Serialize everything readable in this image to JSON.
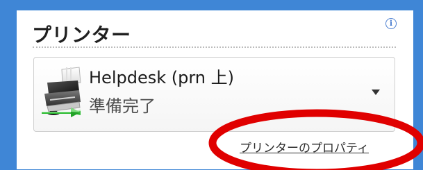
{
  "printer_section": {
    "title": "プリンター",
    "info_icon": "info-icon",
    "selected_printer": {
      "name": "Helpdesk (prn 上)",
      "status": "準備完了",
      "icon": "printer-icon"
    },
    "dropdown_icon": "chevron-down-icon",
    "properties_link": "プリンターのプロパティ"
  },
  "colors": {
    "frame": "#3f86d6",
    "panel_background": "#ffffff",
    "annotation": "#e00000",
    "info_icon": "#4a7ed0"
  }
}
